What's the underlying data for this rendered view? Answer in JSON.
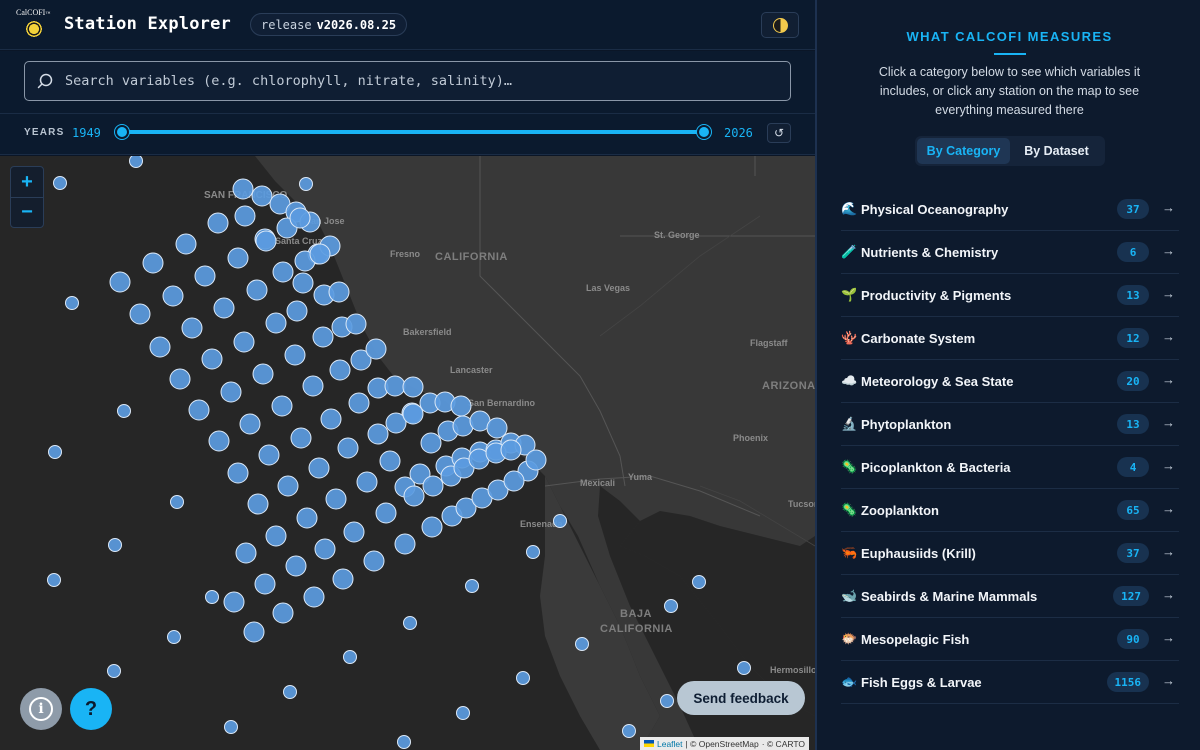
{
  "header": {
    "logo_text": "CalCOFI",
    "logo_tm": "™",
    "title": "Station Explorer",
    "release_label": "release",
    "release_version": "v2026.08.25"
  },
  "search": {
    "placeholder": "Search variables (e.g. chlorophyll, nitrate, salinity)…"
  },
  "years": {
    "label": "YEARS",
    "start": "1949",
    "end": "2026",
    "reset_symbol": "↺"
  },
  "map": {
    "zoom_in": "+",
    "zoom_out": "−",
    "cities": [
      "SAN FRANCISCO",
      "Fresno",
      "St. George",
      "Las Vegas",
      "Bakersfield",
      "Flagstaff",
      "Lancaster",
      "San Bernardino",
      "Phoenix",
      "Yuma",
      "Mexicali",
      "Ensenada",
      "Tucson",
      "Hermosillo",
      "San Jose",
      "Santa Cruz"
    ],
    "states": [
      "CALIFORNIA",
      "ARIZONA",
      "BAJA",
      "CALIFORNIA"
    ],
    "info_symbol": "i",
    "help_symbol": "?",
    "feedback_label": "Send feedback",
    "attribution": {
      "leaflet": "Leaflet",
      "osm": "| © OpenStreetMap",
      "carto": "· © CARTO"
    }
  },
  "panel": {
    "title": "WHAT CALCOFI MEASURES",
    "description": "Click a category below to see which variables it includes, or click any station on the map to see everything measured there",
    "tabs": [
      {
        "label": "By Category",
        "active": true
      },
      {
        "label": "By Dataset",
        "active": false
      }
    ],
    "categories": [
      {
        "emoji": "🌊",
        "label": "Physical Oceanography",
        "count": "37"
      },
      {
        "emoji": "🧪",
        "label": "Nutrients & Chemistry",
        "count": "6"
      },
      {
        "emoji": "🌱",
        "label": "Productivity & Pigments",
        "count": "13"
      },
      {
        "emoji": "🪸",
        "label": "Carbonate System",
        "count": "12"
      },
      {
        "emoji": "☁️",
        "label": "Meteorology & Sea State",
        "count": "20"
      },
      {
        "emoji": "🔬",
        "label": "Phytoplankton",
        "count": "13"
      },
      {
        "emoji": "🦠",
        "label": "Picoplankton & Bacteria",
        "count": "4"
      },
      {
        "emoji": "🦠",
        "label": "Zooplankton",
        "count": "65"
      },
      {
        "emoji": "🦐",
        "label": "Euphausiids (Krill)",
        "count": "37"
      },
      {
        "emoji": "🐋",
        "label": "Seabirds & Marine Mammals",
        "count": "127"
      },
      {
        "emoji": "🐡",
        "label": "Mesopelagic Fish",
        "count": "90"
      },
      {
        "emoji": "🐟",
        "label": "Fish Eggs & Larvae",
        "count": "1156"
      }
    ],
    "arrow": "→"
  }
}
